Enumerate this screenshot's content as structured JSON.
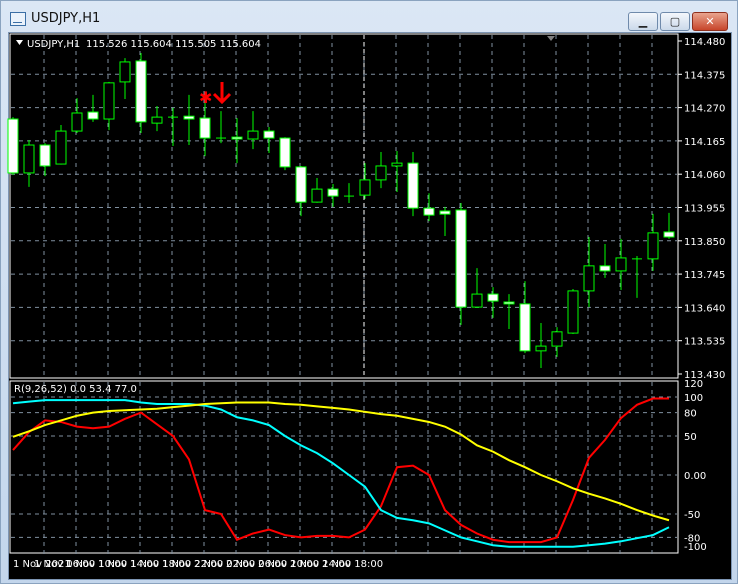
{
  "window": {
    "title": "USDJPY,H1",
    "buttons": {
      "minimize": "▁",
      "restore": "▢",
      "close": "✕"
    }
  },
  "chart_data": [
    {
      "type": "candlestick",
      "title": "USDJPY,H1",
      "ohlc_header": "115.526 115.604 115.505 115.604",
      "ylim": [
        113.43,
        114.48
      ],
      "y_ticks": [
        "114.480",
        "114.375",
        "114.270",
        "114.165",
        "114.060",
        "113.955",
        "113.850",
        "113.745",
        "113.640",
        "113.535",
        "113.430"
      ],
      "x_ticks": [
        "1 Nov 2021",
        "1 Nov 06:00",
        "1 Nov 10:00",
        "1 Nov 14:00",
        "1 Nov 18:00",
        "1 Nov 22:00",
        "2 Nov 02:00",
        "2 Nov 06:00",
        "2 Nov 10:00",
        "2 Nov 14:00",
        "2 Nov 18:00"
      ],
      "grid": true,
      "colors": {
        "background": "#000000",
        "candle_outline": "#00ff00",
        "bear_fill": "#ffffff",
        "bull_fill": "#000000",
        "grid": "#8090a0",
        "marker": "#ff0000"
      },
      "markers": [
        {
          "candle_index": 12,
          "type": "star"
        },
        {
          "candle_index": 13,
          "type": "down-arrow"
        }
      ],
      "candles": [
        [
          114.234,
          114.24,
          114.058,
          114.064
        ],
        [
          114.064,
          114.168,
          114.02,
          114.152
        ],
        [
          114.152,
          114.158,
          114.054,
          114.086
        ],
        [
          114.092,
          114.215,
          114.09,
          114.196
        ],
        [
          114.196,
          114.3,
          114.19,
          114.253
        ],
        [
          114.256,
          114.31,
          114.225,
          114.234
        ],
        [
          114.234,
          114.351,
          114.199,
          114.348
        ],
        [
          114.351,
          114.426,
          114.297,
          114.414
        ],
        [
          114.417,
          114.442,
          114.19,
          114.225
        ],
        [
          114.221,
          114.275,
          114.196,
          114.24
        ],
        [
          114.24,
          114.269,
          114.149,
          114.24
        ],
        [
          114.243,
          114.31,
          114.152,
          114.234
        ],
        [
          114.237,
          114.291,
          114.117,
          114.174
        ],
        [
          114.174,
          114.259,
          114.158,
          114.174
        ],
        [
          114.177,
          114.237,
          114.095,
          114.171
        ],
        [
          114.171,
          114.259,
          114.139,
          114.196
        ],
        [
          114.196,
          114.209,
          114.127,
          114.174
        ],
        [
          114.174,
          114.177,
          114.073,
          114.083
        ],
        [
          114.083,
          114.086,
          113.928,
          113.972
        ],
        [
          113.972,
          114.048,
          113.97,
          114.013
        ],
        [
          114.013,
          114.029,
          113.957,
          113.991
        ],
        [
          113.991,
          114.032,
          113.969,
          113.991
        ],
        [
          113.994,
          114.095,
          113.982,
          114.042
        ],
        [
          114.042,
          114.13,
          114.016,
          114.086
        ],
        [
          114.086,
          114.133,
          114.004,
          114.095
        ],
        [
          114.095,
          114.13,
          113.928,
          113.953
        ],
        [
          113.953,
          114.0,
          113.912,
          113.931
        ],
        [
          113.944,
          113.957,
          113.865,
          113.934
        ],
        [
          113.947,
          113.969,
          113.585,
          113.641
        ],
        [
          113.641,
          113.764,
          113.638,
          113.682
        ],
        [
          113.682,
          113.704,
          113.607,
          113.66
        ],
        [
          113.657,
          113.682,
          113.572,
          113.651
        ],
        [
          113.651,
          113.723,
          113.496,
          113.503
        ],
        [
          113.503,
          113.591,
          113.449,
          113.518
        ],
        [
          113.518,
          113.578,
          113.484,
          113.563
        ],
        [
          113.559,
          113.698,
          113.556,
          113.692
        ],
        [
          113.692,
          113.862,
          113.641,
          113.771
        ],
        [
          113.771,
          113.84,
          113.733,
          113.755
        ],
        [
          113.755,
          113.856,
          113.695,
          113.796
        ],
        [
          113.793,
          113.802,
          113.67,
          113.793
        ],
        [
          113.793,
          113.935,
          113.755,
          113.875
        ],
        [
          113.878,
          113.938,
          113.856,
          113.862
        ]
      ]
    },
    {
      "type": "line",
      "title": "R(9,26,52) 0.0 53.4 77.0",
      "ylim": [
        -120,
        120
      ],
      "y_ticks": [
        "120",
        "100",
        "80",
        "50",
        "0.00",
        "-50",
        "-80",
        "-100"
      ],
      "grid": true,
      "series": [
        {
          "color": "#ff0000",
          "values": [
            32,
            55,
            70,
            68,
            62,
            60,
            62,
            72,
            80,
            65,
            50,
            20,
            -45,
            -50,
            -83,
            -75,
            -70,
            -77,
            -80,
            -78,
            -78,
            -80,
            -70,
            -40,
            10,
            12,
            0,
            -45,
            -64,
            -75,
            -83,
            -86,
            -86,
            -86,
            -80,
            -32,
            22,
            45,
            73,
            90,
            98,
            98
          ]
        },
        {
          "color": "#00ffff",
          "values": [
            92,
            94,
            96,
            96,
            96,
            96,
            96,
            96,
            93,
            91,
            91,
            91,
            89,
            84,
            74,
            70,
            64,
            50,
            38,
            28,
            15,
            0,
            -15,
            -45,
            -55,
            -58,
            -62,
            -71,
            -80,
            -85,
            -90,
            -92,
            -92,
            -92,
            -92,
            -92,
            -90,
            -88,
            -85,
            -81,
            -77,
            -67
          ]
        },
        {
          "color": "#ffff00",
          "values": [
            49,
            56,
            64,
            70,
            76,
            80,
            82,
            83,
            84,
            85,
            87,
            89,
            91,
            92,
            93,
            93,
            93,
            91,
            90,
            88,
            86,
            84,
            81,
            78,
            76,
            72,
            68,
            62,
            52,
            38,
            30,
            19,
            10,
            0,
            -8,
            -17,
            -24,
            -30,
            -37,
            -45,
            -52,
            -58
          ]
        }
      ]
    }
  ]
}
